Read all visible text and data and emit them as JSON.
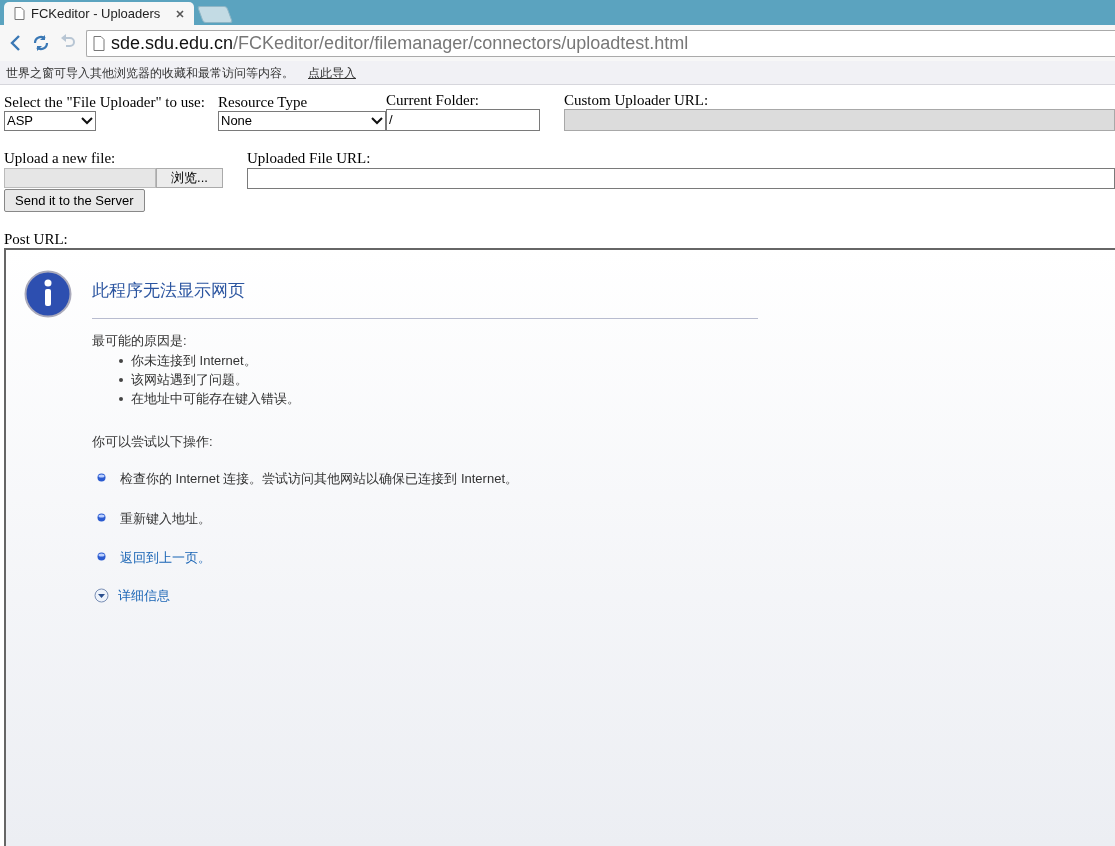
{
  "browser": {
    "tab": {
      "title": "FCKeditor - Uploaders",
      "selected": true
    },
    "address": {
      "host": "sde.sdu.edu.cn",
      "path": "/FCKeditor/editor/filemanager/connectors/uploadtest.html"
    },
    "infobar": {
      "message": "世界之窗可导入其他浏览器的收藏和最常访问等内容。",
      "link": "点此导入"
    }
  },
  "form": {
    "uploader": {
      "label": "Select the \"File Uploader\" to use:",
      "value": "ASP"
    },
    "resource_type": {
      "label": "Resource Type",
      "value": "None"
    },
    "current_folder": {
      "label": "Current Folder:",
      "value": "/"
    },
    "custom_url": {
      "label": "Custom Uploader URL:",
      "disabled": true
    },
    "upload": {
      "label": "Upload a new file:",
      "browse_button": "浏览..."
    },
    "uploaded_url": {
      "label": "Uploaded File URL:"
    },
    "send_button": "Send it to the Server",
    "post_url": {
      "label": "Post URL:"
    }
  },
  "error_page": {
    "title": "此程序无法显示网页",
    "reasons_heading": "最可能的原因是:",
    "reasons": [
      "你未连接到 Internet。",
      "该网站遇到了问题。",
      "在地址中可能存在键入错误。"
    ],
    "try_heading": "你可以尝试以下操作:",
    "actions": [
      {
        "kind": "text",
        "text": "检查你的 Internet 连接。尝试访问其他网站以确保已连接到 Internet。"
      },
      {
        "kind": "text",
        "text": "重新键入地址。"
      },
      {
        "kind": "link",
        "text": "返回到上一页。"
      }
    ],
    "details": {
      "label": "详细信息",
      "expanded": false
    }
  }
}
